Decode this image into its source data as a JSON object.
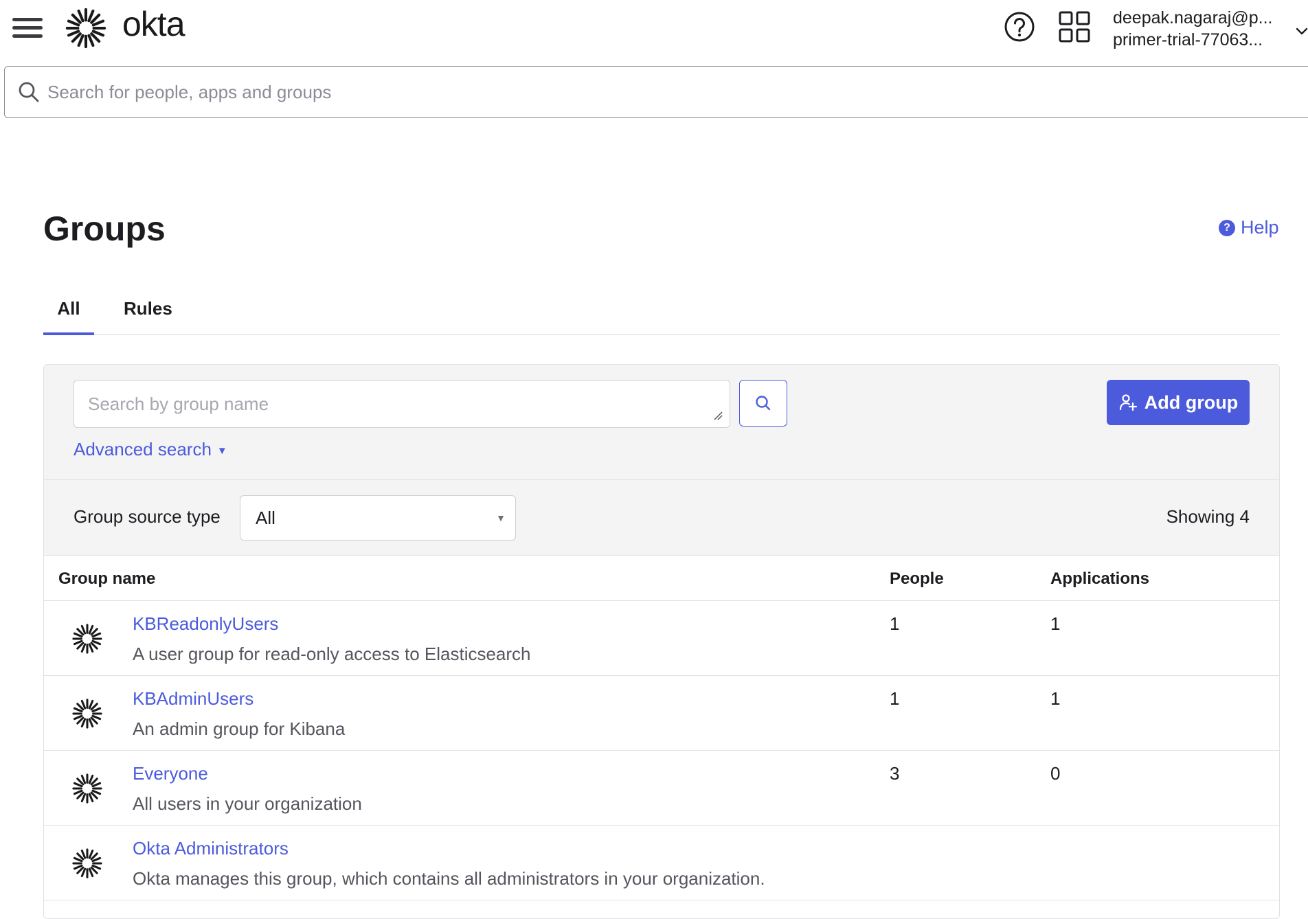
{
  "header": {
    "logo_text": "okta",
    "user_email": "deepak.nagaraj@p...",
    "user_org": "primer-trial-77063...",
    "global_search_placeholder": "Search for people, apps and groups"
  },
  "page": {
    "title": "Groups",
    "help_label": "Help",
    "help_dot": "?"
  },
  "tabs": [
    {
      "label": "All",
      "active": true
    },
    {
      "label": "Rules",
      "active": false
    }
  ],
  "toolbar": {
    "search_placeholder": "Search by group name",
    "advanced_search_label": "Advanced search",
    "add_group_label": "Add group"
  },
  "filter": {
    "label": "Group source type",
    "selected": "All",
    "showing_text": "Showing 4"
  },
  "table": {
    "headers": {
      "name": "Group name",
      "people": "People",
      "applications": "Applications"
    },
    "rows": [
      {
        "name": "KBReadonlyUsers",
        "description": "A user group for read-only access to Elasticsearch",
        "people": "1",
        "applications": "1"
      },
      {
        "name": "KBAdminUsers",
        "description": "An admin group for Kibana",
        "people": "1",
        "applications": "1"
      },
      {
        "name": "Everyone",
        "description": "All users in your organization",
        "people": "3",
        "applications": "0"
      },
      {
        "name": "Okta Administrators",
        "description": "Okta manages this group, which contains all administrators in your organization.",
        "people": "",
        "applications": ""
      }
    ]
  },
  "colors": {
    "accent": "#4b5bdc",
    "panel_bg": "#f4f4f5",
    "border": "#e1e1e6",
    "text": "#1d1d21"
  },
  "icons": {
    "menu": "hamburger-icon",
    "logo": "okta-sunburst-icon",
    "help": "question-circle-icon",
    "apps": "grid-icon",
    "search": "search-icon",
    "add_group": "add-group-icon",
    "group": "okta-sunburst-icon"
  }
}
